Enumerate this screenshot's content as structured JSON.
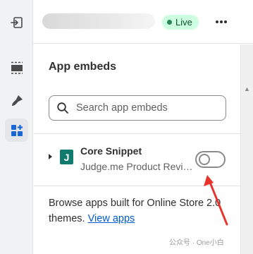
{
  "topbar": {
    "live_badge": "Live",
    "more_icon": "ellipsis-horizontal-icon"
  },
  "sidebar": {
    "items": [
      {
        "name": "exit",
        "icon": "exit-icon"
      },
      {
        "name": "sections",
        "icon": "sections-icon"
      },
      {
        "name": "theme-settings",
        "icon": "paintbrush-icon"
      },
      {
        "name": "app-embeds",
        "icon": "apps-icon",
        "active": true
      }
    ]
  },
  "panel": {
    "title": "App embeds",
    "search": {
      "placeholder": "Search app embeds",
      "value": ""
    },
    "embeds": [
      {
        "name": "Core Snippet",
        "app": "Judge.me Product Revie...",
        "logo_letter": "J",
        "enabled": false
      }
    ],
    "browse_text": "Browse apps built for Online Store 2.0 themes.",
    "view_apps_link": "View apps"
  },
  "watermark": "公众号 · One小白",
  "colors": {
    "live_badge_bg": "#cdfee1",
    "live_dot": "#29845a",
    "app_logo": "#117a6f",
    "link": "#005bd3",
    "annotation_arrow": "#e8332a"
  }
}
